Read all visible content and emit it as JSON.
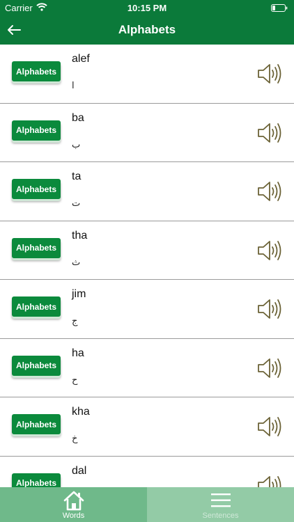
{
  "status_bar": {
    "carrier": "Carrier",
    "time": "10:15 PM"
  },
  "header": {
    "title": "Alphabets"
  },
  "items": [
    {
      "badge": "Alphabets",
      "word": "alef",
      "arabic": "ا"
    },
    {
      "badge": "Alphabets",
      "word": "ba",
      "arabic": "ب"
    },
    {
      "badge": "Alphabets",
      "word": "ta",
      "arabic": "ت"
    },
    {
      "badge": "Alphabets",
      "word": "tha",
      "arabic": "ث"
    },
    {
      "badge": "Alphabets",
      "word": "jim",
      "arabic": "ج"
    },
    {
      "badge": "Alphabets",
      "word": "ha",
      "arabic": "ح"
    },
    {
      "badge": "Alphabets",
      "word": "kha",
      "arabic": "خ"
    },
    {
      "badge": "Alphabets",
      "word": "dal",
      "arabic": ""
    }
  ],
  "tabs": [
    {
      "label": "Words",
      "icon": "home-icon"
    },
    {
      "label": "Sentences",
      "icon": "menu-icon"
    }
  ],
  "colors": {
    "header": "#0b7a3a",
    "badge": "#0b8a3c",
    "speaker": "#6b6236",
    "tab_active": "#6fb98a",
    "tab_inactive": "#93cba6"
  }
}
